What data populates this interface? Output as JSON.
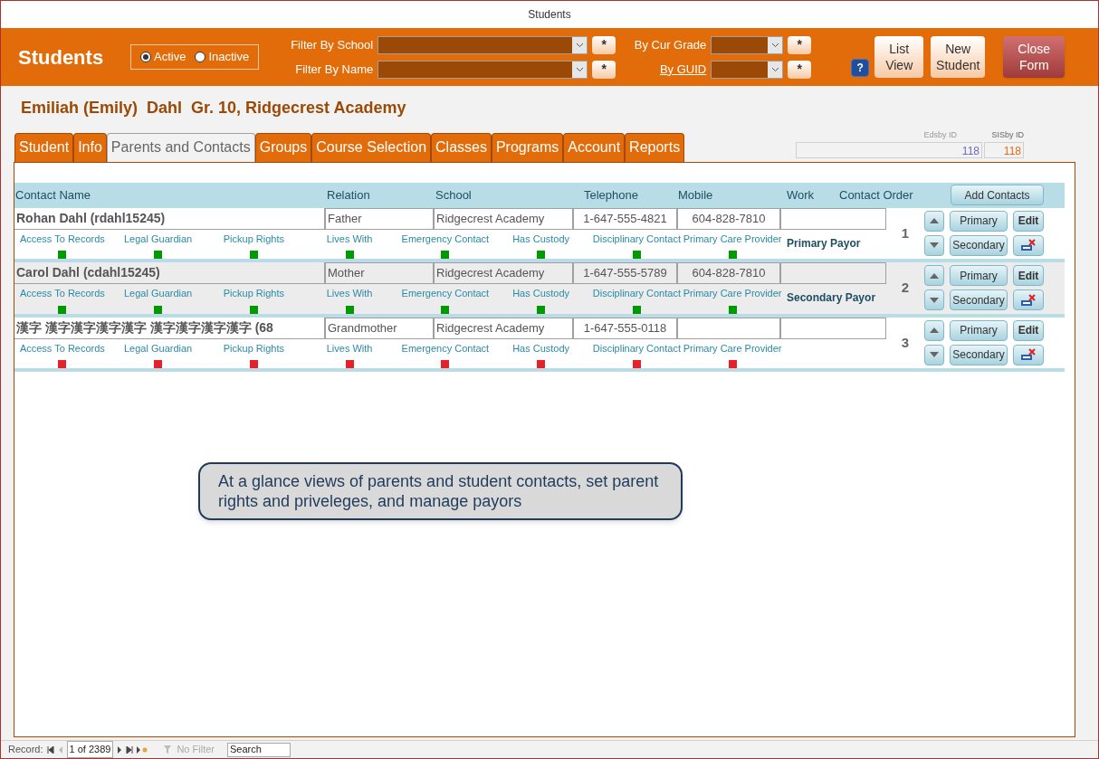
{
  "window": {
    "title": "Students"
  },
  "header": {
    "title": "Students",
    "status_options": [
      {
        "label": "Active",
        "selected": true
      },
      {
        "label": "Inactive",
        "selected": false
      }
    ],
    "filters": [
      {
        "label": "Filter By School",
        "link": false,
        "clear": "*"
      },
      {
        "label": "Filter By Name",
        "link": false,
        "clear": "*"
      }
    ],
    "filters_right": [
      {
        "label": "By Cur Grade",
        "link": false,
        "clear": "*"
      },
      {
        "label": "By GUID",
        "link": true,
        "clear": "*"
      }
    ],
    "help": "?",
    "buttons": [
      {
        "label": "List View",
        "kind": "light"
      },
      {
        "label": "New Student",
        "kind": "light"
      },
      {
        "label": "Close Form",
        "kind": "dark"
      }
    ]
  },
  "student_heading": "Emiliah (Emily)  Dahl  Gr. 10, Ridgecrest Academy",
  "tabs": [
    {
      "label": "Student",
      "selected": false
    },
    {
      "label": "Info",
      "selected": false
    },
    {
      "label": "Parents and Contacts",
      "selected": true
    },
    {
      "label": "Groups",
      "selected": false
    },
    {
      "label": "Course Selection",
      "selected": false
    },
    {
      "label": "Classes",
      "selected": false
    },
    {
      "label": "Programs",
      "selected": false
    },
    {
      "label": "Account",
      "selected": false
    },
    {
      "label": "Reports",
      "selected": false
    }
  ],
  "ids": {
    "edsby_label": "Edsby ID",
    "edsby_value": "118",
    "sisby_label": "SISby ID",
    "sisby_value": "118"
  },
  "table": {
    "columns": [
      "Contact Name",
      "Relation",
      "School",
      "Telephone",
      "Mobile",
      "Work",
      "Contact Order"
    ],
    "add_button": "Add Contacts",
    "rows": [
      {
        "name": "Rohan Dahl (rdahl15245)",
        "relation": "Father",
        "school": "Ridgecrest Academy",
        "telephone": "1-647-555-4821",
        "mobile": "604-828-7810",
        "order": "1",
        "payor": "Primary Payor",
        "selected": false,
        "rights": [
          {
            "label": "Access To Records",
            "granted": true
          },
          {
            "label": "Legal Guardian",
            "granted": true
          },
          {
            "label": "Pickup Rights",
            "granted": true
          },
          {
            "label": "Lives With",
            "granted": true
          },
          {
            "label": "Emergency Contact",
            "granted": true
          },
          {
            "label": "Has Custody",
            "granted": true
          },
          {
            "label": "Disciplinary Contact",
            "granted": true
          },
          {
            "label": "Primary Care Provider",
            "granted": true
          }
        ],
        "buttons": {
          "primary": "Primary",
          "secondary": "Secondary",
          "edit": "Edit"
        }
      },
      {
        "name": "Carol Dahl (cdahl15245)",
        "relation": "Mother",
        "school": "Ridgecrest Academy",
        "telephone": "1-647-555-5789",
        "mobile": "604-828-7810",
        "order": "2",
        "payor": "Secondary Payor",
        "selected": true,
        "rights": [
          {
            "label": "Access To Records",
            "granted": true
          },
          {
            "label": "Legal Guardian",
            "granted": true
          },
          {
            "label": "Pickup Rights",
            "granted": true
          },
          {
            "label": "Lives With",
            "granted": true
          },
          {
            "label": "Emergency Contact",
            "granted": true
          },
          {
            "label": "Has Custody",
            "granted": true
          },
          {
            "label": "Disciplinary Contact",
            "granted": true
          },
          {
            "label": "Primary Care Provider",
            "granted": true
          }
        ],
        "buttons": {
          "primary": "Primary",
          "secondary": "Secondary",
          "edit": "Edit"
        }
      },
      {
        "name": "漢字 漢字漢字漢字漢字 漢字漢字漢字漢字 (68",
        "relation": "Grandmother",
        "school": "Ridgecrest Academy",
        "telephone": "1-647-555-0118",
        "order": "3",
        "selected": false,
        "rights": [
          {
            "label": "Access To Records",
            "granted": false
          },
          {
            "label": "Legal Guardian",
            "granted": false
          },
          {
            "label": "Pickup Rights",
            "granted": false
          },
          {
            "label": "Lives With",
            "granted": false
          },
          {
            "label": "Emergency Contact",
            "granted": false
          },
          {
            "label": "Has Custody",
            "granted": false
          },
          {
            "label": "Disciplinary Contact",
            "granted": false
          },
          {
            "label": "Primary Care Provider",
            "granted": false
          }
        ],
        "buttons": {
          "primary": "Primary",
          "secondary": "Secondary",
          "edit": "Edit"
        }
      }
    ]
  },
  "callout": "At a glance views of parents and student contacts, set parent rights and priveleges, and manage payors",
  "record_nav": {
    "label": "Record:",
    "position": "1 of 2389",
    "filter": "No Filter",
    "search_placeholder": "Search"
  }
}
